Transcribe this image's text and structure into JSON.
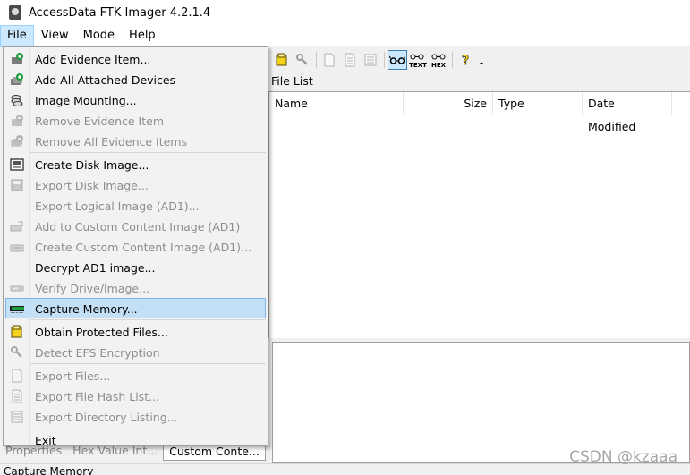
{
  "window": {
    "title": "AccessData FTK Imager 4.2.1.4",
    "icon": "ftk-imager-icon"
  },
  "menubar": {
    "items": [
      {
        "label": "File",
        "name": "menu-file",
        "open": true
      },
      {
        "label": "View",
        "name": "menu-view"
      },
      {
        "label": "Mode",
        "name": "menu-mode"
      },
      {
        "label": "Help",
        "name": "menu-help"
      }
    ]
  },
  "file_menu": {
    "items": [
      {
        "label": "Add Evidence Item...",
        "enabled": true,
        "icon": "add-evidence-icon"
      },
      {
        "label": "Add All Attached Devices",
        "enabled": true,
        "icon": "add-devices-icon"
      },
      {
        "label": "Image Mounting...",
        "enabled": true,
        "icon": "image-mount-icon"
      },
      {
        "label": "Remove Evidence Item",
        "enabled": false,
        "icon": "remove-evidence-icon"
      },
      {
        "label": "Remove All Evidence Items",
        "enabled": false,
        "icon": "remove-all-evidence-icon"
      },
      {
        "label": "Create Disk Image...",
        "enabled": true,
        "icon": "create-disk-image-icon"
      },
      {
        "label": "Export Disk Image...",
        "enabled": false,
        "icon": "export-disk-image-icon"
      },
      {
        "label": "Export Logical Image (AD1)...",
        "enabled": false,
        "icon": ""
      },
      {
        "label": "Add to Custom Content Image (AD1)",
        "enabled": false,
        "icon": "add-custom-content-icon"
      },
      {
        "label": "Create Custom Content Image (AD1)...",
        "enabled": false,
        "icon": "create-custom-content-icon"
      },
      {
        "label": "Decrypt AD1 image...",
        "enabled": true,
        "icon": ""
      },
      {
        "label": "Verify Drive/Image...",
        "enabled": false,
        "icon": "verify-drive-icon"
      },
      {
        "label": "Capture Memory...",
        "enabled": true,
        "icon": "capture-memory-icon",
        "highlighted": true
      },
      {
        "label": "Obtain Protected Files...",
        "enabled": true,
        "icon": "obtain-protected-files-icon"
      },
      {
        "label": "Detect EFS Encryption",
        "enabled": false,
        "icon": "detect-efs-icon"
      },
      {
        "label": "Export Files...",
        "enabled": false,
        "icon": "export-files-icon"
      },
      {
        "label": "Export File Hash List...",
        "enabled": false,
        "icon": "export-hash-list-icon"
      },
      {
        "label": "Export Directory Listing...",
        "enabled": false,
        "icon": "export-directory-listing-icon"
      },
      {
        "label": "Exit",
        "enabled": true,
        "icon": ""
      }
    ]
  },
  "toolbar": {
    "text_view_label": "TEXT",
    "hex_view_label": "HEX"
  },
  "file_list": {
    "header": "File List",
    "columns": [
      "Name",
      "Size",
      "Type",
      "Date Modified"
    ]
  },
  "bottom_tabs": [
    {
      "label": "Properties",
      "selected": false
    },
    {
      "label": "Hex Value Int...",
      "selected": false
    },
    {
      "label": "Custom Conte...",
      "selected": true
    }
  ],
  "status": {
    "text": "Capture Memory"
  },
  "watermark": "CSDN @kzaaa",
  "colors": {
    "menu_highlight": "#c2dff5",
    "menu_highlight_border": "#7eb4ea",
    "disabled_text": "#8d8d8d",
    "accent_green": "#1a9c3a",
    "accent_yellow": "#f2d21b"
  }
}
